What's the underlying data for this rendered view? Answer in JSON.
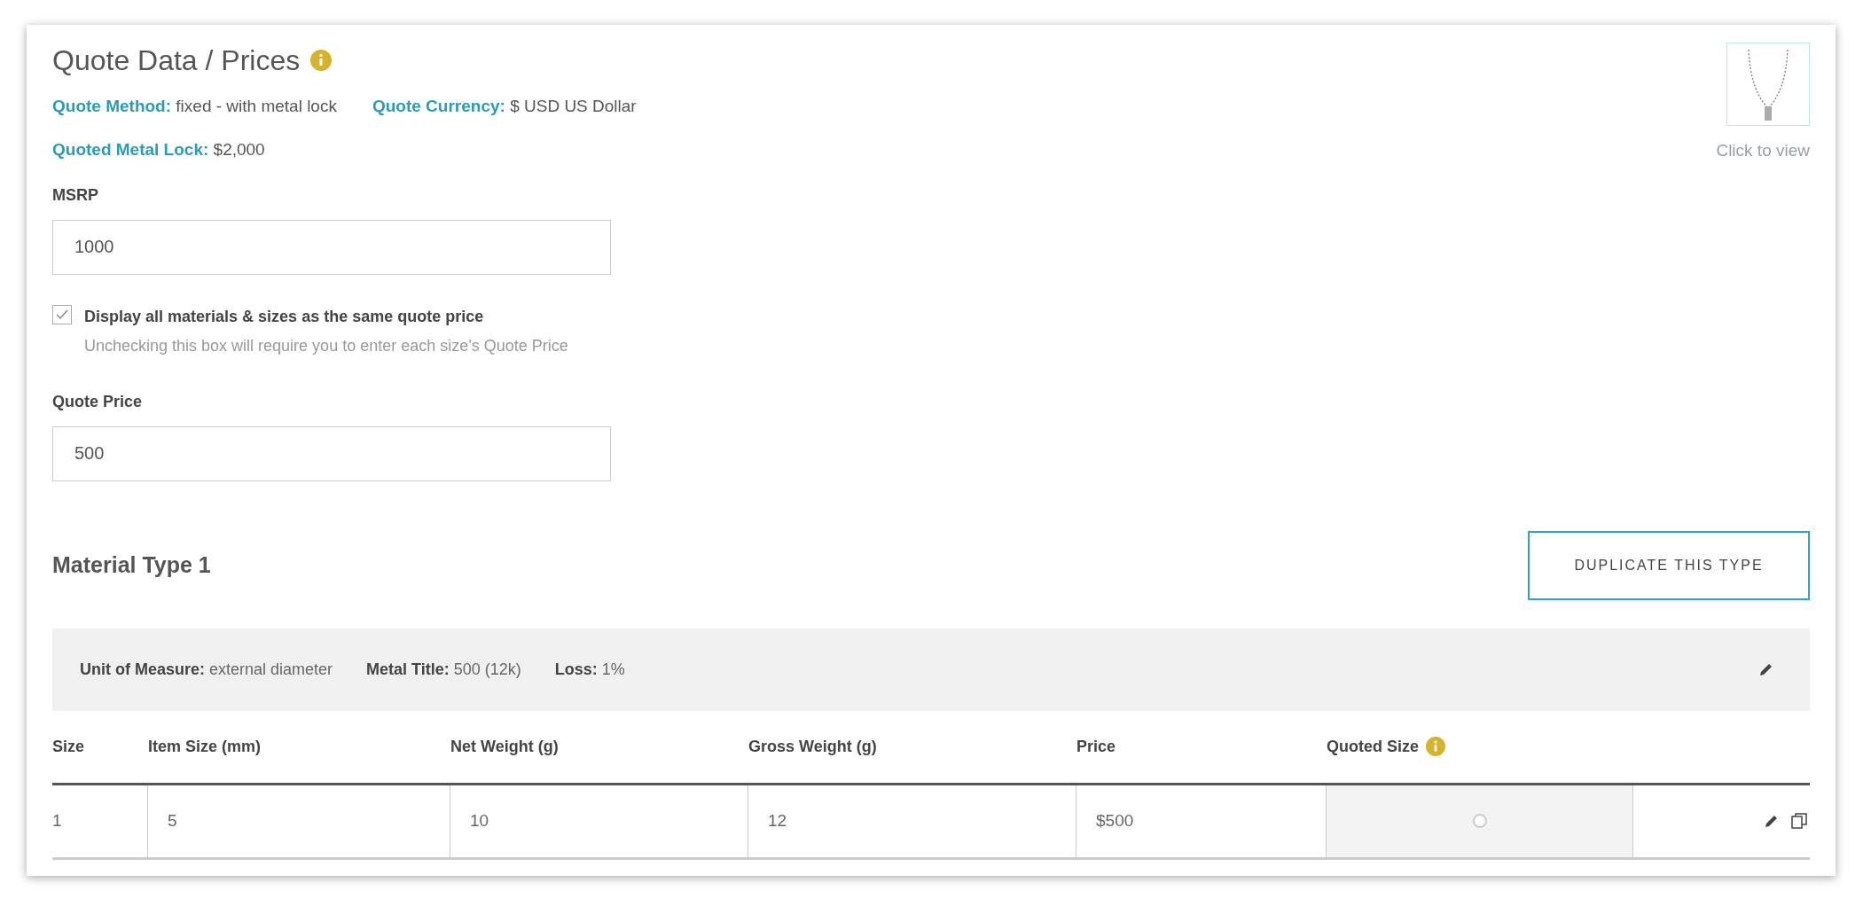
{
  "title": "Quote Data / Prices",
  "meta": [
    {
      "label": "Quote Method:",
      "value": "fixed - with metal lock"
    },
    {
      "label": "Quote Currency:",
      "value": "$ USD US Dollar"
    },
    {
      "label": "Quoted Metal Lock:",
      "value": "$2,000"
    }
  ],
  "thumbnail": {
    "caption": "Click to view"
  },
  "msrp": {
    "label": "MSRP",
    "value": "1000"
  },
  "same_price": {
    "label": "Display all materials & sizes as the same quote price",
    "hint": "Unchecking this box will require you to enter each size's Quote Price",
    "checked": true
  },
  "quote_price": {
    "label": "Quote Price",
    "value": "500"
  },
  "material": {
    "title": "Material Type 1",
    "button": "DUPLICATE THIS TYPE",
    "attributes": [
      {
        "label": "Unit of Measure:",
        "value": "external diameter"
      },
      {
        "label": "Metal Title:",
        "value": "500 (12k)"
      },
      {
        "label": "Loss:",
        "value": "1%"
      }
    ],
    "columns": [
      "Size",
      "Item Size (mm)",
      "Net Weight (g)",
      "Gross Weight (g)",
      "Price",
      "Quoted Size"
    ],
    "rows": [
      {
        "size": "1",
        "item_size": "5",
        "net_weight": "10",
        "gross_weight": "12",
        "price": "$500",
        "quoted": false
      }
    ]
  }
}
